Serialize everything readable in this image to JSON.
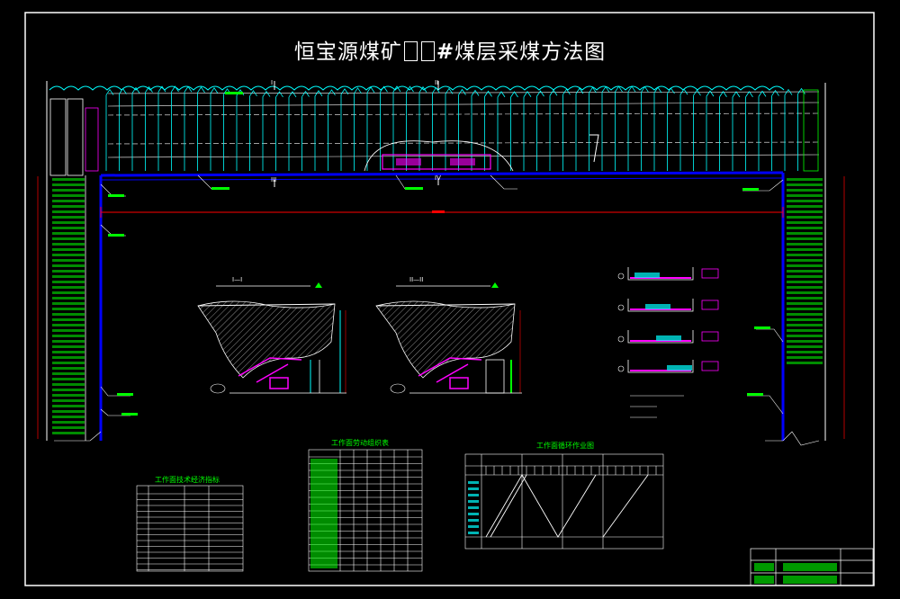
{
  "drawing": {
    "title_prefix": "恒宝源煤矿",
    "title_hash": "#",
    "title_suffix": "煤层采煤方法图",
    "section_marks": [
      "I",
      "II",
      "III",
      "IV"
    ],
    "sections": {
      "section_1_label": "I—I",
      "section_2_label": "II—II"
    },
    "tables": {
      "tech_table_title": "工作面技术经济指标",
      "labor_table_title": "工作面劳动组织表",
      "cycle_table_title": "工作面循环作业图"
    },
    "colors": {
      "background": "#000000",
      "roadway": "#0000ff",
      "support": "#00ffff",
      "equipment": "#ff00ff",
      "annotation": "#00ff00",
      "linework": "#ffffff",
      "dimension": "#ff0000",
      "hatch": "#ffffff"
    },
    "icons": [
      "north-arrow-icon"
    ]
  }
}
